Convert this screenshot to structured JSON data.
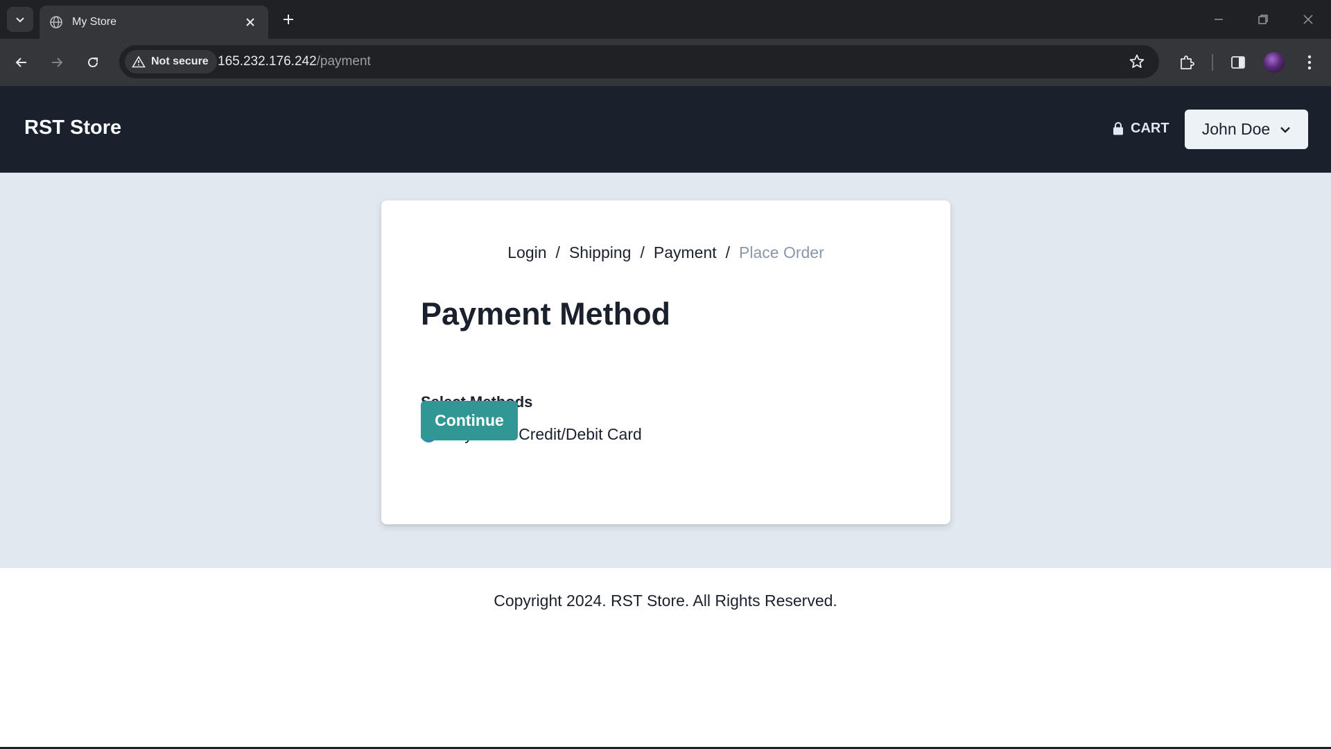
{
  "browser": {
    "tab_title": "My Store",
    "security_label": "Not secure",
    "url_host": "165.232.176.242",
    "url_path": "/payment"
  },
  "header": {
    "brand": "RST Store",
    "cart_label": "CART",
    "user_name": "John Doe"
  },
  "checkout": {
    "steps": [
      "Login",
      "Shipping",
      "Payment",
      "Place Order"
    ],
    "separator": "/",
    "title": "Payment Method",
    "methods_label": "Select Methods",
    "method_option": "PayPal or Credit/Debit Card",
    "method_selected": true,
    "continue_label": "Continue"
  },
  "footer": {
    "copyright": "Copyright 2024. RST Store. All Rights Reserved."
  },
  "colors": {
    "header_bg": "#1a202c",
    "page_bg": "#e2e8f0",
    "button_teal": "#319795",
    "radio_blue": "#3182ce",
    "disabled_step": "#8a97a8"
  }
}
